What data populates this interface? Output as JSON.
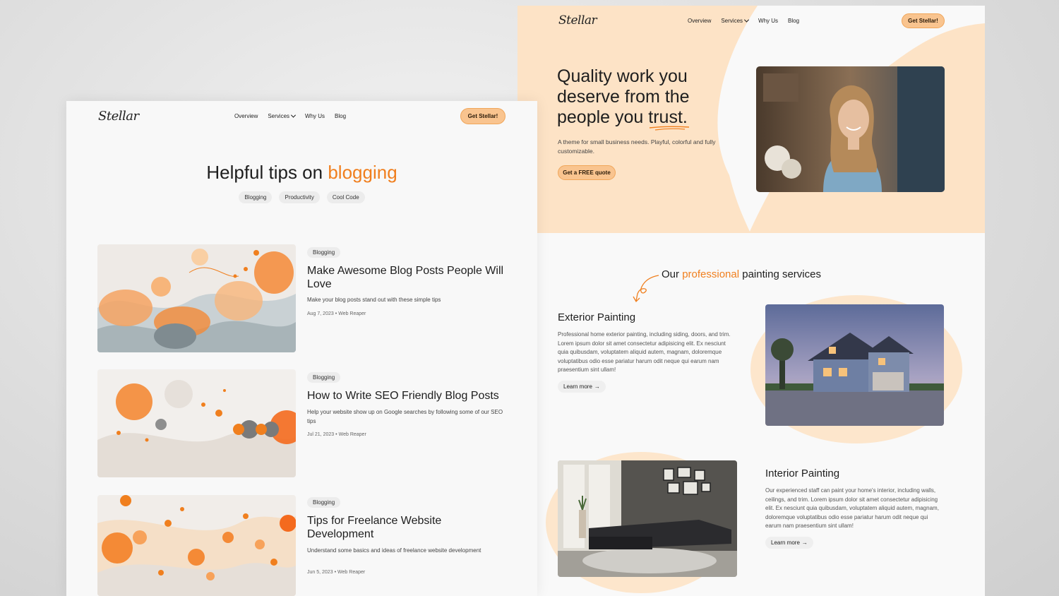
{
  "brand": {
    "logo_text": "Stellar",
    "accent_color": "#f07f1e",
    "peach_color": "#fde3c6",
    "cta_fill": "#f9c48f"
  },
  "nav": {
    "items": [
      "Overview",
      "Services",
      "Why Us",
      "Blog"
    ],
    "cta": "Get Stellar!"
  },
  "home": {
    "hero_title_line1": "Quality work you",
    "hero_title_line2": "deserve from the",
    "hero_title_line3_pre": "people you",
    "hero_title_line3_word": "trust.",
    "hero_subtitle": "A theme for small business needs. Playful, colorful and fully customizable.",
    "hero_cta": "Get a FREE quote",
    "services_heading_pre": "Our",
    "services_heading_accent": "professional",
    "services_heading_post": "painting services",
    "services": [
      {
        "title": "Exterior Painting",
        "description": "Professional home exterior painting, including siding, doors, and trim. Lorem ipsum dolor sit amet consectetur adipisicing elit. Ex nesciunt quia quibusdam, voluptatem aliquid autem, magnam, doloremque voluptatibus odio esse pariatur harum odit neque qui earum nam praesentium sint ullam!",
        "link": "Learn more"
      },
      {
        "title": "Interior Painting",
        "description": "Our experienced staff can paint your home's interior, including walls, ceilings, and trim. Lorem ipsum dolor sit amet consectetur adipisicing elit. Ex nesciunt quia quibusdam, voluptatem aliquid autem, magnam, doloremque voluptatibus odio esse pariatur harum odit neque qui earum nam praesentium sint ullam!",
        "link": "Learn more"
      }
    ]
  },
  "blog": {
    "title_pre": "Helpful tips on",
    "title_accent": "blogging",
    "chips": [
      "Blogging",
      "Productivity",
      "Cool Code"
    ],
    "posts": [
      {
        "category": "Blogging",
        "title": "Make Awesome Blog Posts People Will Love",
        "excerpt": "Make your blog posts stand out with these simple tips",
        "date": "Aug 7, 2023",
        "author": "Web Reaper"
      },
      {
        "category": "Blogging",
        "title": "How to Write SEO Friendly Blog Posts",
        "excerpt": "Help your website show up on Google searches by following some of our SEO tips",
        "date": "Jul 21, 2023",
        "author": "Web Reaper"
      },
      {
        "category": "Blogging",
        "title": "Tips for Freelance Website Development",
        "excerpt": "Understand some basics and ideas of freelance website development",
        "date": "Jun 5, 2023",
        "author": "Web Reaper"
      }
    ]
  }
}
